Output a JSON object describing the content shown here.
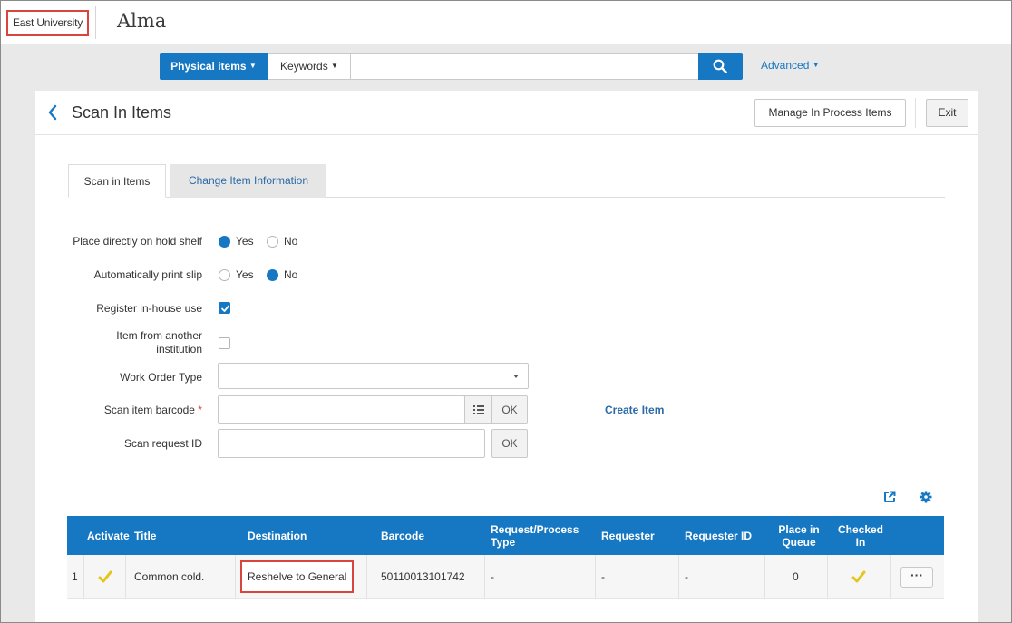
{
  "header": {
    "institution": "East University",
    "app_title": "Alma"
  },
  "search": {
    "type_label": "Physical items",
    "field_label": "Keywords",
    "query": "",
    "advanced_label": "Advanced"
  },
  "page": {
    "title": "Scan In Items",
    "manage_button": "Manage In Process Items",
    "exit_button": "Exit"
  },
  "tabs": [
    {
      "label": "Scan in Items",
      "active": true
    },
    {
      "label": "Change Item Information",
      "active": false
    }
  ],
  "form": {
    "hold_shelf": {
      "label": "Place directly on hold shelf",
      "yes": "Yes",
      "no": "No",
      "value": "Yes"
    },
    "print_slip": {
      "label": "Automatically print slip",
      "yes": "Yes",
      "no": "No",
      "value": "No"
    },
    "in_house_use": {
      "label": "Register in-house use",
      "checked": true
    },
    "other_institution": {
      "label_line1": "Item from another",
      "label_line2": "institution",
      "checked": false
    },
    "work_order_type": {
      "label": "Work Order Type",
      "value": ""
    },
    "barcode": {
      "label": "Scan item barcode",
      "required_mark": "*",
      "value": "",
      "ok_label": "OK"
    },
    "request_id": {
      "label": "Scan request ID",
      "value": "",
      "ok_label": "OK"
    },
    "create_item_label": "Create Item"
  },
  "table": {
    "headers": {
      "activate": "Activate",
      "title": "Title",
      "destination": "Destination",
      "barcode": "Barcode",
      "request_type_1": "Request/Process",
      "request_type_2": "Type",
      "requester": "Requester",
      "requester_id": "Requester ID",
      "queue_1": "Place in",
      "queue_2": "Queue",
      "checked_1": "Checked",
      "checked_2": "In"
    },
    "rows": [
      {
        "index": "1",
        "title": "Common cold.",
        "destination": "Reshelve to General",
        "barcode": "50110013101742",
        "request_type": "-",
        "requester": "-",
        "requester_id": "-",
        "place_in_queue": "0",
        "more": "···"
      }
    ]
  },
  "colors": {
    "primary": "#1677c2",
    "highlight": "#d9443c",
    "check": "#e6c51a"
  }
}
